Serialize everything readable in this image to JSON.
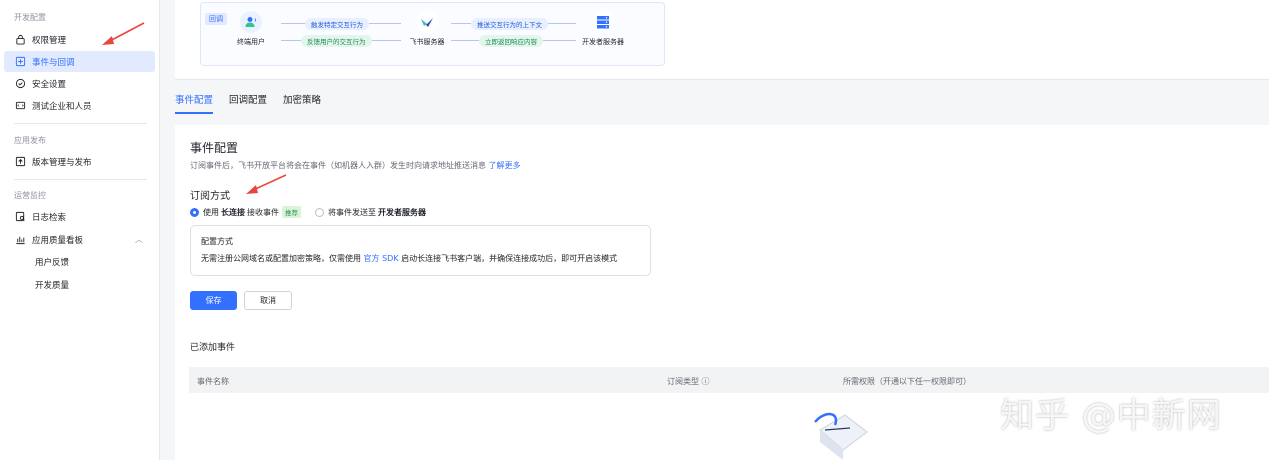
{
  "sidebar": {
    "groups": [
      {
        "title": "开发配置",
        "items": [
          {
            "label": "权限管理",
            "icon": "lock-icon"
          },
          {
            "label": "事件与回调",
            "icon": "event-icon",
            "active": true
          },
          {
            "label": "安全设置",
            "icon": "shield-check-icon"
          },
          {
            "label": "测试企业和人员",
            "icon": "test-icon"
          }
        ]
      },
      {
        "title": "应用发布",
        "items": [
          {
            "label": "版本管理与发布",
            "icon": "upload-icon"
          }
        ]
      },
      {
        "title": "运营监控",
        "items": [
          {
            "label": "日志检索",
            "icon": "log-search-icon"
          },
          {
            "label": "应用质量看板",
            "icon": "chart-icon"
          },
          {
            "label": "用户反馈"
          },
          {
            "label": "开发质量"
          }
        ]
      }
    ]
  },
  "flow": {
    "tag": "回调",
    "nodes": [
      "终端用户",
      "飞书服务器",
      "开发者服务器"
    ],
    "pills": [
      "触发特定交互行为",
      "反馈用户的交互行为",
      "推送交互行为的上下文",
      "立即返回响应内容"
    ]
  },
  "tabs": [
    "事件配置",
    "回调配置",
    "加密策略"
  ],
  "main": {
    "title": "事件配置",
    "description": "订阅事件后，飞书开放平台将会在事件（如机器人入群）发生时向请求地址推送消息",
    "learn_more": "了解更多",
    "subscribe_title": "订阅方式",
    "option1_prefix": "使用",
    "option1_bold": "长连接",
    "option1_suffix": "接收事件",
    "option1_badge": "推荐",
    "option2_prefix": "将事件发送至",
    "option2_bold": "开发者服务器",
    "info_title": "配置方式",
    "info_text_pre": "无需注册公网域名或配置加密策略，仅需使用",
    "info_link": "官方 SDK",
    "info_text_post": "启动长连接飞书客户端，并确保连接成功后，即可开启该模式",
    "save": "保存",
    "cancel": "取消",
    "added_title": "已添加事件",
    "columns": [
      "事件名称",
      "订阅类型 ⓘ",
      "所需权限（开通以下任一权限即可）"
    ]
  },
  "watermark": "知乎 @中新网",
  "colors": {
    "accent": "#3370ff",
    "active_bg": "#e1eaff",
    "arrow_red": "#e8473b"
  }
}
